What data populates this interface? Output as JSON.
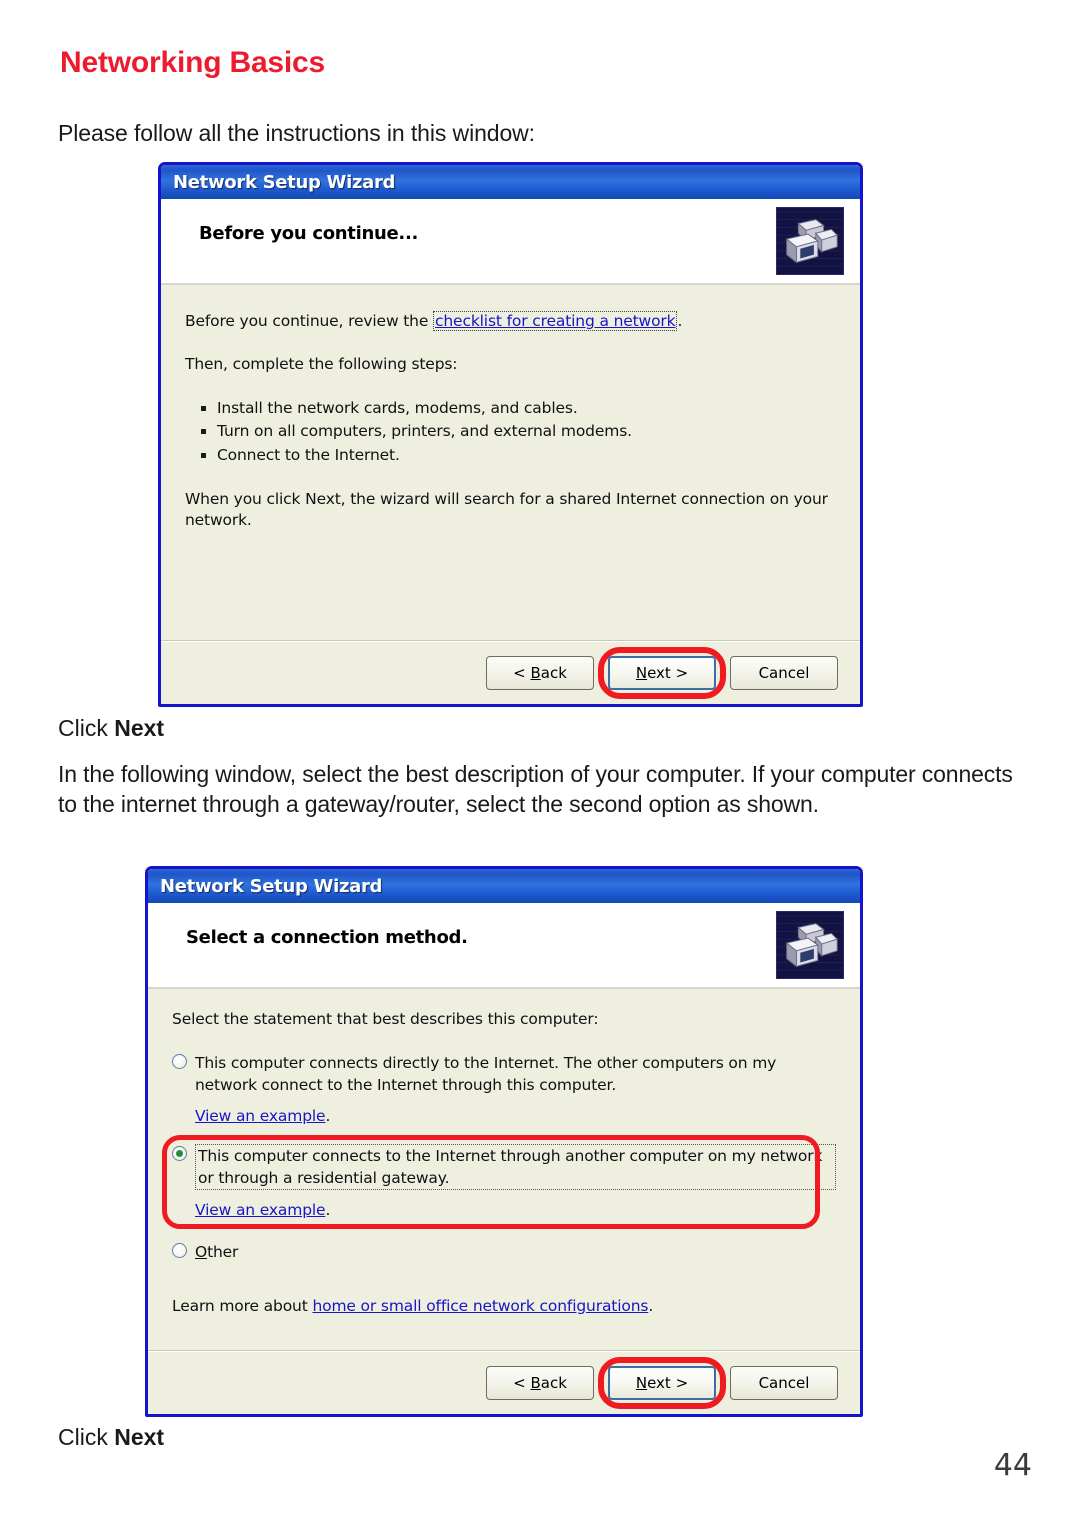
{
  "page": {
    "title": "Networking Basics",
    "title_color": "#ED1B2E",
    "intro": "Please follow all the instructions in this window:",
    "click_next_prefix": "Click ",
    "click_next_bold": "Next",
    "paragraph": "In the following window, select the best description of your computer.  If your computer connects to the internet through a gateway/router, select the second option as shown.",
    "page_number": "44"
  },
  "wizard1": {
    "titlebar": "Network Setup Wizard",
    "header_title": "Before you continue...",
    "icon": "network-computers-icon",
    "body": {
      "line1_prefix": "Before you continue, review the ",
      "line1_link": "checklist for creating a network",
      "line1_suffix": ".",
      "line2": "Then, complete the following steps:",
      "steps": [
        "Install the network cards, modems, and cables.",
        "Turn on all computers, printers, and external modems.",
        "Connect to the Internet."
      ],
      "line3": "When you click Next, the wizard will search for a shared Internet connection on your network."
    },
    "buttons": {
      "back": "< Back",
      "back_accel": "B",
      "next": "Next >",
      "next_accel": "N",
      "cancel": "Cancel",
      "highlight_color": "#F01A21",
      "highlighted": "next"
    }
  },
  "wizard2": {
    "titlebar": "Network Setup Wizard",
    "header_title": "Select a connection method.",
    "icon": "network-computers-icon",
    "body": {
      "intro": "Select the statement that best describes this computer:",
      "options": [
        {
          "id": "direct",
          "selected": false,
          "text": "This computer connects directly to the Internet. The other computers on my network connect to the Internet through this computer.",
          "sub_link": "View an example",
          "sub_suffix": ".",
          "highlighted": false
        },
        {
          "id": "through-gateway",
          "selected": true,
          "text": "This computer connects to the Internet through another computer on my network or through a residential gateway.",
          "sub_link": "View an example",
          "sub_suffix": ".",
          "highlighted": true
        },
        {
          "id": "other",
          "selected": false,
          "text": "Other",
          "sub_link": null,
          "sub_suffix": null,
          "highlighted": false
        }
      ],
      "learn_prefix": "Learn more about ",
      "learn_link": "home or small office network configurations",
      "learn_suffix": "."
    },
    "buttons": {
      "back": "< Back",
      "back_accel": "B",
      "next": "Next >",
      "next_accel": "N",
      "cancel": "Cancel",
      "highlight_color": "#F01A21",
      "highlighted": "next"
    }
  }
}
